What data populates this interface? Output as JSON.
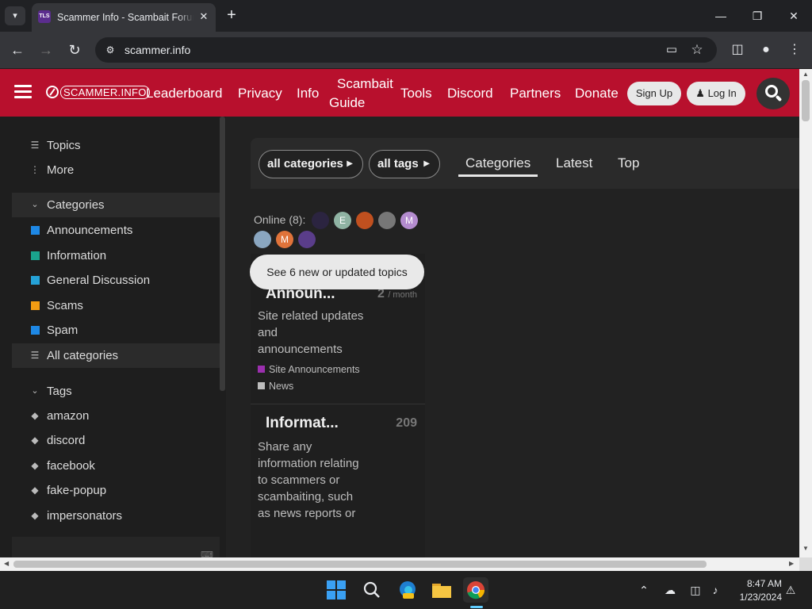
{
  "browser": {
    "tab_title": "Scammer Info - Scambait Forum",
    "favicon_text": "TLS",
    "url": "scammer.info",
    "window_controls": [
      "minimize",
      "restore",
      "close"
    ]
  },
  "site": {
    "logo_text": "SCAMMER.INFO",
    "nav": [
      "Leaderboard",
      "Privacy",
      "Info",
      "Scambait",
      "Guide",
      "Tools",
      "Discord",
      "Partners",
      "Donate"
    ],
    "signup_label": "Sign Up",
    "login_label": "Log In",
    "brand_color": "#b8102d"
  },
  "sidebar": {
    "top_items": [
      {
        "label": "Topics",
        "icon": "layers-icon"
      },
      {
        "label": "More",
        "icon": "vertical-ellipsis-icon"
      }
    ],
    "categories_header": "Categories",
    "categories": [
      {
        "label": "Announcements",
        "color": "#1e88e5"
      },
      {
        "label": "Information",
        "color": "#1aa38d"
      },
      {
        "label": "General Discussion",
        "color": "#25a2d7"
      },
      {
        "label": "Scams",
        "color": "#f39c12"
      },
      {
        "label": "Spam",
        "color": "#1e88e5"
      }
    ],
    "all_categories_label": "All categories",
    "tags_header": "Tags",
    "tags": [
      "amazon",
      "discord",
      "facebook",
      "fake-popup",
      "impersonators"
    ]
  },
  "main": {
    "filters": {
      "categories_label": "all categories",
      "tags_label": "all tags"
    },
    "tabs": [
      "Categories",
      "Latest",
      "Top"
    ],
    "active_tab": "Categories",
    "online_label": "Online (8):",
    "online_avatars": [
      {
        "letter": "",
        "color": "#2b2440"
      },
      {
        "letter": "E",
        "color": "#8fb3a3"
      },
      {
        "letter": "",
        "color": "#c0501f"
      },
      {
        "letter": "",
        "color": "#777777"
      },
      {
        "letter": "M",
        "color": "#b48ccf"
      },
      {
        "letter": "",
        "color": "#8aa6c0"
      },
      {
        "letter": "M",
        "color": "#e0733a"
      },
      {
        "letter": "",
        "color": "#5a3d8a"
      }
    ],
    "new_topics_banner": "See 6 new or updated topics",
    "category_cards": [
      {
        "title": "Announ...",
        "count": "2",
        "count_unit": "/ month",
        "description": "Site related updates and announcements",
        "subcategories": [
          {
            "label": "Site Announcements",
            "color": "#9b2fae"
          },
          {
            "label": "News",
            "color": "#bdbdbd"
          }
        ]
      },
      {
        "title": "Informat...",
        "count": "209",
        "count_unit": "",
        "description": "Share any information relating to scammers or scambaiting, such as news reports or",
        "subcategories": []
      }
    ]
  },
  "taskbar": {
    "apps": [
      "windows-start-icon",
      "search-icon",
      "edge-beta-icon",
      "file-explorer-icon",
      "chrome-icon"
    ],
    "time": "8:47 AM",
    "date": "1/23/2024"
  }
}
